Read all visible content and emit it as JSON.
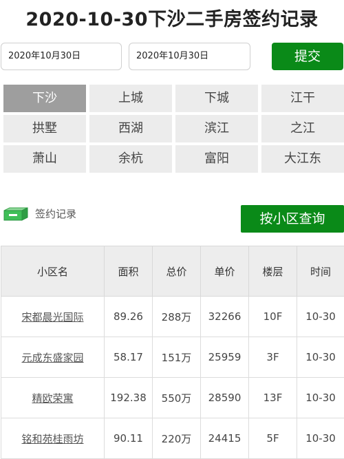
{
  "header": {
    "title": "2020-10-30下沙二手房签约记录"
  },
  "search": {
    "start_date": "2020年10月30日",
    "end_date": "2020年10月30日",
    "submit_label": "提交"
  },
  "districts": {
    "active": "下沙",
    "items": [
      "下沙",
      "上城",
      "下城",
      "江干",
      "拱墅",
      "西湖",
      "滨江",
      "之江",
      "萧山",
      "余杭",
      "富阳",
      "大江东"
    ]
  },
  "section": {
    "label": "签约记录",
    "query_button": "按小区查询"
  },
  "table": {
    "headers": [
      "小区名",
      "面积",
      "总价",
      "单价",
      "楼层",
      "时间"
    ],
    "rows": [
      [
        "宋都晨光国际",
        "89.26",
        "288万",
        "32266",
        "10F",
        "10-30"
      ],
      [
        "元成东盛家园",
        "58.17",
        "151万",
        "25959",
        "3F",
        "10-30"
      ],
      [
        "精欧荣寓",
        "192.38",
        "550万",
        "28590",
        "13F",
        "10-30"
      ],
      [
        "铭和苑桂雨坊",
        "90.11",
        "220万",
        "24415",
        "5F",
        "10-30"
      ]
    ]
  },
  "colors": {
    "accent": "#0a8a18",
    "active_district": "#9e9e9e",
    "district_bg": "#ececec"
  }
}
